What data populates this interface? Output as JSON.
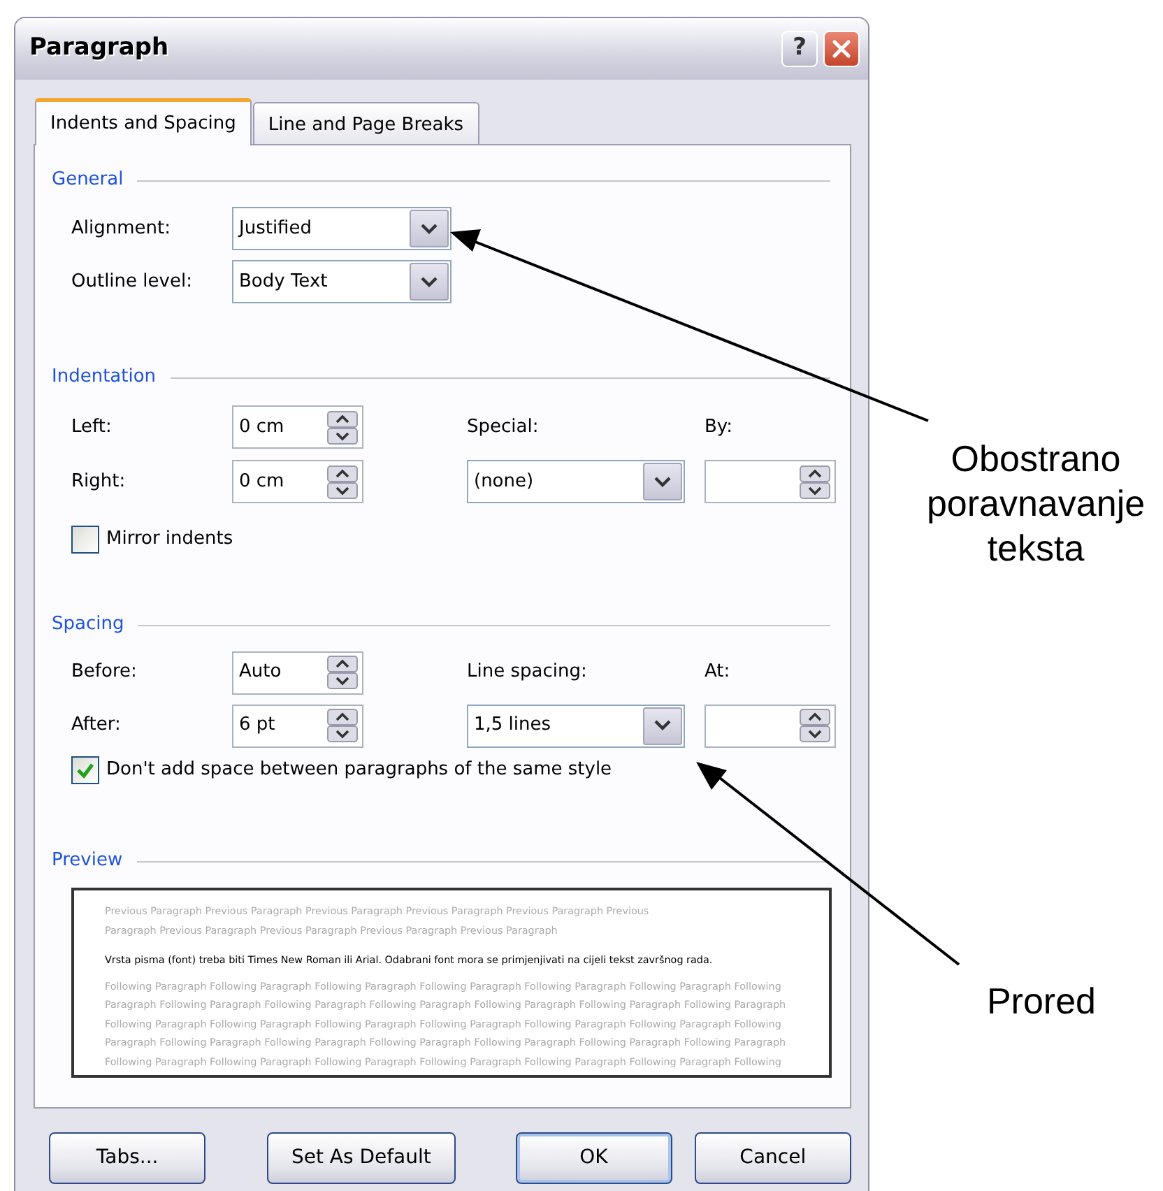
{
  "window": {
    "title": "Paragraph",
    "help": "?"
  },
  "tabs": [
    {
      "label": "Indents and Spacing",
      "selected": true
    },
    {
      "label": "Line and Page Breaks",
      "selected": false
    }
  ],
  "general": {
    "title": "General",
    "fields": [
      {
        "label": "Alignment:",
        "value": "Justified"
      },
      {
        "label": "Outline level:",
        "value": "Body Text"
      }
    ]
  },
  "indentation": {
    "title": "Indentation",
    "left": {
      "label": "Left:",
      "value": "0 cm"
    },
    "right": {
      "label": "Right:",
      "value": "0 cm"
    },
    "special": {
      "label": "Special:",
      "value": "(none)"
    },
    "by": {
      "label": "By:"
    },
    "mirror": {
      "label": "Mirror indents",
      "checked": false
    }
  },
  "spacing": {
    "title": "Spacing",
    "before": {
      "label": "Before:",
      "value": "Auto"
    },
    "after": {
      "label": "After:",
      "value": "6 pt"
    },
    "line_spacing": {
      "label": "Line spacing:",
      "value": "1,5 lines"
    },
    "at": {
      "label": "At:"
    },
    "no_space": {
      "label": "Don't add space between paragraphs of the same style",
      "checked": true
    }
  },
  "preview": {
    "title": "Preview",
    "previous_lines": [
      "Previous Paragraph Previous Paragraph Previous Paragraph Previous Paragraph Previous Paragraph Previous",
      "Paragraph Previous Paragraph Previous Paragraph Previous Paragraph Previous Paragraph"
    ],
    "current_text": "Vrsta pisma (font) treba biti Times New Roman ili Arial. Odabrani font mora se primjenjivati na cijeli tekst završnog rada.",
    "following_lines": [
      "Following Paragraph Following Paragraph Following Paragraph Following Paragraph Following Paragraph Following Paragraph Following",
      "Paragraph Following Paragraph Following Paragraph Following Paragraph Following Paragraph Following Paragraph Following Paragraph",
      "Following Paragraph Following Paragraph Following Paragraph Following Paragraph Following Paragraph Following Paragraph Following",
      "Paragraph Following Paragraph Following Paragraph Following Paragraph Following Paragraph Following Paragraph Following Paragraph",
      "Following Paragraph Following Paragraph Following Paragraph Following Paragraph Following Paragraph Following Paragraph Following"
    ]
  },
  "buttons": [
    {
      "label": "Tabs...",
      "default": false
    },
    {
      "label": "Set As Default",
      "default": false
    },
    {
      "label": "OK",
      "default": true
    },
    {
      "label": "Cancel",
      "default": false
    }
  ],
  "annotations": [
    {
      "text": "Obostrano poravnavanje teksta"
    },
    {
      "text": "Prored"
    }
  ]
}
